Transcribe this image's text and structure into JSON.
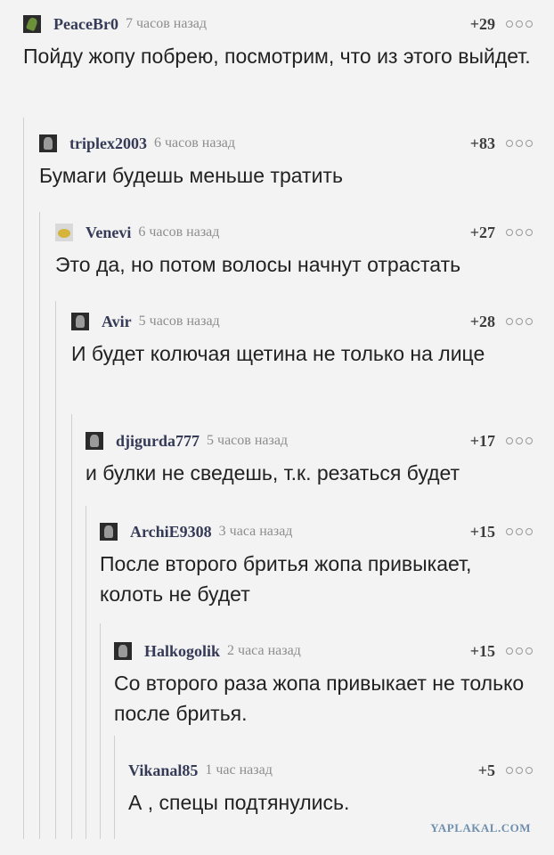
{
  "comments": [
    {
      "username": "PeaceBr0",
      "time": "7 часов назад",
      "score": "+29",
      "text": "Пойду жопу побрею, посмотрим, что из этого выйдет.",
      "avatar_icon": "leaf-icon"
    },
    {
      "username": "triplex2003",
      "time": "6 часов назад",
      "score": "+83",
      "text": "Бумаги будешь меньше тратить",
      "avatar_icon": "avatar-icon"
    },
    {
      "username": "Venevi",
      "time": "6 часов назад",
      "score": "+27",
      "text": "Это да, но потом волосы начнут отрастать",
      "avatar_icon": "bee-icon"
    },
    {
      "username": "Avir",
      "time": "5 часов назад",
      "score": "+28",
      "text": "И будет колючая щетина не только на лице",
      "avatar_icon": "avatar-icon"
    },
    {
      "username": "djigurda777",
      "time": "5 часов назад",
      "score": "+17",
      "text": "и булки не сведешь, т.к. резаться будет",
      "avatar_icon": "avatar-icon"
    },
    {
      "username": "ArchiE9308",
      "time": "3 часа назад",
      "score": "+15",
      "text": "После второго бритья жопа привыкает, колоть не будет",
      "avatar_icon": "avatar-icon"
    },
    {
      "username": "Halkogolik",
      "time": "2 часа назад",
      "score": "+15",
      "text": "Со второго раза жопа привыкает не только после бритья.",
      "avatar_icon": "avatar-icon"
    },
    {
      "username": "Vikanal85",
      "time": "1 час назад",
      "score": "+5",
      "text": "А , спецы подтянулись.",
      "avatar_icon": ""
    }
  ],
  "watermark": "YAPLAKAL.COM"
}
